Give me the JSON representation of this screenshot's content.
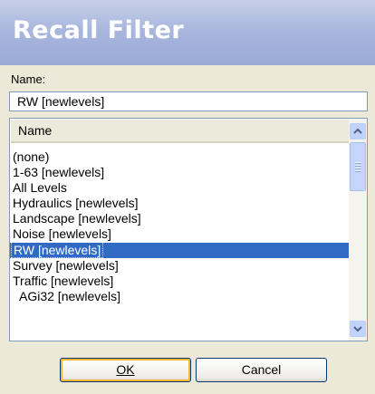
{
  "dialog": {
    "title": "Recall Filter",
    "name_label": "Name:",
    "name_value": "RW [newlevels]",
    "ok_label": "OK",
    "cancel_label": "Cancel"
  },
  "list": {
    "column_header": "Name",
    "items": [
      {
        "label": "(none)",
        "indent": false,
        "selected": false
      },
      {
        "label": "1-63 [newlevels]",
        "indent": false,
        "selected": false
      },
      {
        "label": "All Levels",
        "indent": false,
        "selected": false
      },
      {
        "label": "Hydraulics [newlevels]",
        "indent": false,
        "selected": false
      },
      {
        "label": "Landscape [newlevels]",
        "indent": false,
        "selected": false
      },
      {
        "label": "Noise [newlevels]",
        "indent": false,
        "selected": false
      },
      {
        "label": "RW [newlevels]",
        "indent": false,
        "selected": true
      },
      {
        "label": "Survey [newlevels]",
        "indent": false,
        "selected": false
      },
      {
        "label": "Traffic [newlevels]",
        "indent": false,
        "selected": false
      },
      {
        "label": "AGi32 [newlevels]",
        "indent": true,
        "selected": false
      }
    ]
  },
  "icons": {
    "scroll_up": "scroll-up-arrow-icon",
    "scroll_down": "scroll-down-arrow-icon"
  },
  "colors": {
    "selection": "#316ac5",
    "title_gradient": "#a9b7de",
    "dialog_bg": "#ece9d8"
  }
}
